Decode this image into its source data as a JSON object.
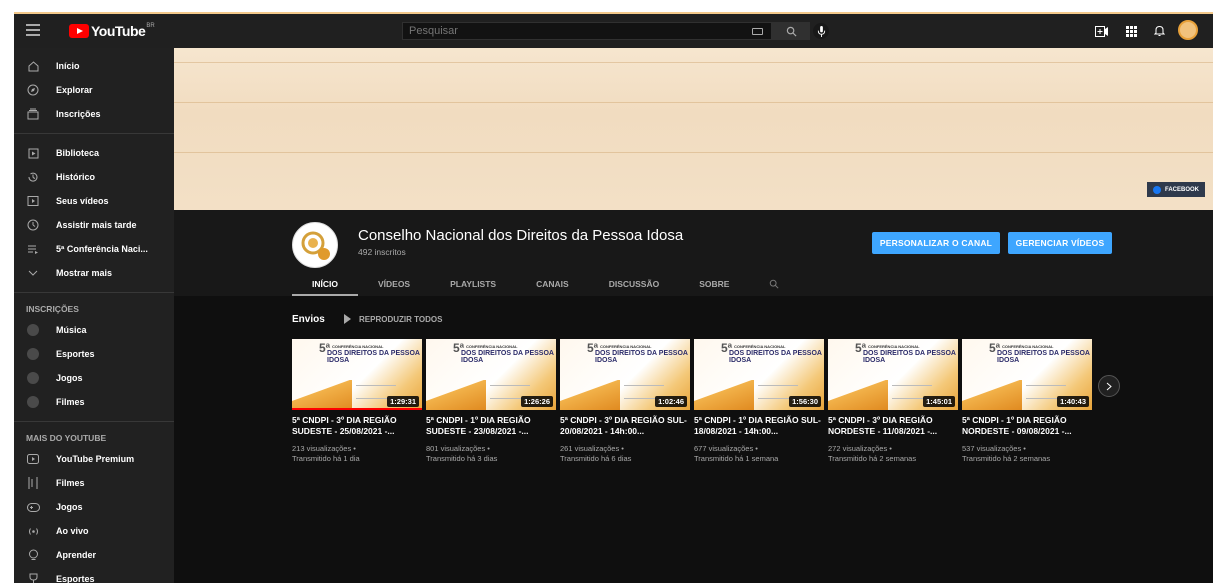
{
  "topbar": {
    "logo_text": "YouTube",
    "logo_region": "BR",
    "search_placeholder": "Pesquisar"
  },
  "sidebar": {
    "main": [
      {
        "label": "Início",
        "icon": "home-icon"
      },
      {
        "label": "Explorar",
        "icon": "compass-icon"
      },
      {
        "label": "Inscrições",
        "icon": "subscriptions-icon"
      }
    ],
    "library": [
      {
        "label": "Biblioteca",
        "icon": "library-icon"
      },
      {
        "label": "Histórico",
        "icon": "history-icon"
      },
      {
        "label": "Seus vídeos",
        "icon": "your-videos-icon"
      },
      {
        "label": "Assistir mais tarde",
        "icon": "watch-later-icon"
      },
      {
        "label": "5ª Conferência Naci...",
        "icon": "playlist-icon"
      },
      {
        "label": "Mostrar mais",
        "icon": "chevron-down-icon"
      }
    ],
    "subs_heading": "INSCRIÇÕES",
    "subscriptions": [
      {
        "label": "Música"
      },
      {
        "label": "Esportes"
      },
      {
        "label": "Jogos"
      },
      {
        "label": "Filmes"
      }
    ],
    "more_heading": "MAIS DO YOUTUBE",
    "more": [
      {
        "label": "YouTube Premium",
        "icon": "youtube-premium-icon"
      },
      {
        "label": "Filmes",
        "icon": "film-icon"
      },
      {
        "label": "Jogos",
        "icon": "gamepad-icon"
      },
      {
        "label": "Ao vivo",
        "icon": "live-icon"
      },
      {
        "label": "Aprender",
        "icon": "learn-icon"
      },
      {
        "label": "Esportes",
        "icon": "trophy-icon"
      }
    ]
  },
  "banner": {
    "link_label": "FACEBOOK"
  },
  "channel": {
    "name": "Conselho Nacional dos Direitos da Pessoa Idosa",
    "subscribers": "492 inscritos",
    "customize_label": "PERSONALIZAR O CANAL",
    "manage_label": "GERENCIAR VÍDEOS",
    "tabs": [
      "INÍCIO",
      "VÍDEOS",
      "PLAYLISTS",
      "CANAIS",
      "DISCUSSÃO",
      "SOBRE"
    ]
  },
  "uploads": {
    "title": "Envios",
    "play_all": "REPRODUZIR TODOS",
    "thumb_num": "5ª",
    "thumb_l1": "CONFERÊNCIA NACIONAL",
    "thumb_l2": "DOS DIREITOS DA PESSOA IDOSA",
    "videos": [
      {
        "title": "5ª CNDPI - 3º DIA REGIÃO SUDESTE - 25/08/2021 -...",
        "duration": "1:29:31",
        "views": "213 visualizações •",
        "when": "Transmitido há 1 dia",
        "watched": true
      },
      {
        "title": "5ª CNDPI - 1º DIA REGIÃO SUDESTE - 23/08/2021 -...",
        "duration": "1:26:26",
        "views": "801 visualizações •",
        "when": "Transmitido há 3 dias",
        "watched": false
      },
      {
        "title": "5ª CNDPI - 3º DIA REGIÃO SUL- 20/08/2021 - 14h:00...",
        "duration": "1:02:46",
        "views": "261 visualizações •",
        "when": "Transmitido há 6 dias",
        "watched": false
      },
      {
        "title": "5ª CNDPI - 1º DIA REGIÃO SUL- 18/08/2021 - 14h:00...",
        "duration": "1:56:30",
        "views": "677 visualizações •",
        "when": "Transmitido há 1 semana",
        "watched": false
      },
      {
        "title": "5ª CNDPI - 3º DIA REGIÃO NORDESTE - 11/08/2021 -...",
        "duration": "1:45:01",
        "views": "272 visualizações •",
        "when": "Transmitido há 2 semanas",
        "watched": false
      },
      {
        "title": "5ª CNDPI - 1º DIA REGIÃO NORDESTE - 09/08/2021 -...",
        "duration": "1:40:43",
        "views": "537 visualizações •",
        "when": "Transmitido há 2 semanas",
        "watched": false
      }
    ]
  }
}
